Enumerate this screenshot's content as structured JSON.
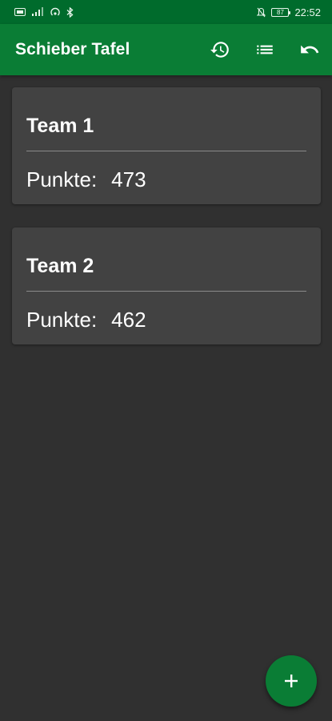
{
  "status_bar": {
    "battery": "87",
    "time": "22:52"
  },
  "app_bar": {
    "title": "Schieber Tafel",
    "actions": [
      {
        "name": "history",
        "icon": "history-icon"
      },
      {
        "name": "list",
        "icon": "list-icon"
      },
      {
        "name": "undo",
        "icon": "undo-icon"
      }
    ]
  },
  "teams": [
    {
      "name": "Team 1",
      "points_label": "Punkte:",
      "points": "473"
    },
    {
      "name": "Team 2",
      "points_label": "Punkte:",
      "points": "462"
    }
  ],
  "fab": {
    "icon": "plus-icon"
  },
  "colors": {
    "primary": "#0a7d35",
    "status_bar": "#006b2c",
    "background": "#303030",
    "card": "#424242"
  }
}
